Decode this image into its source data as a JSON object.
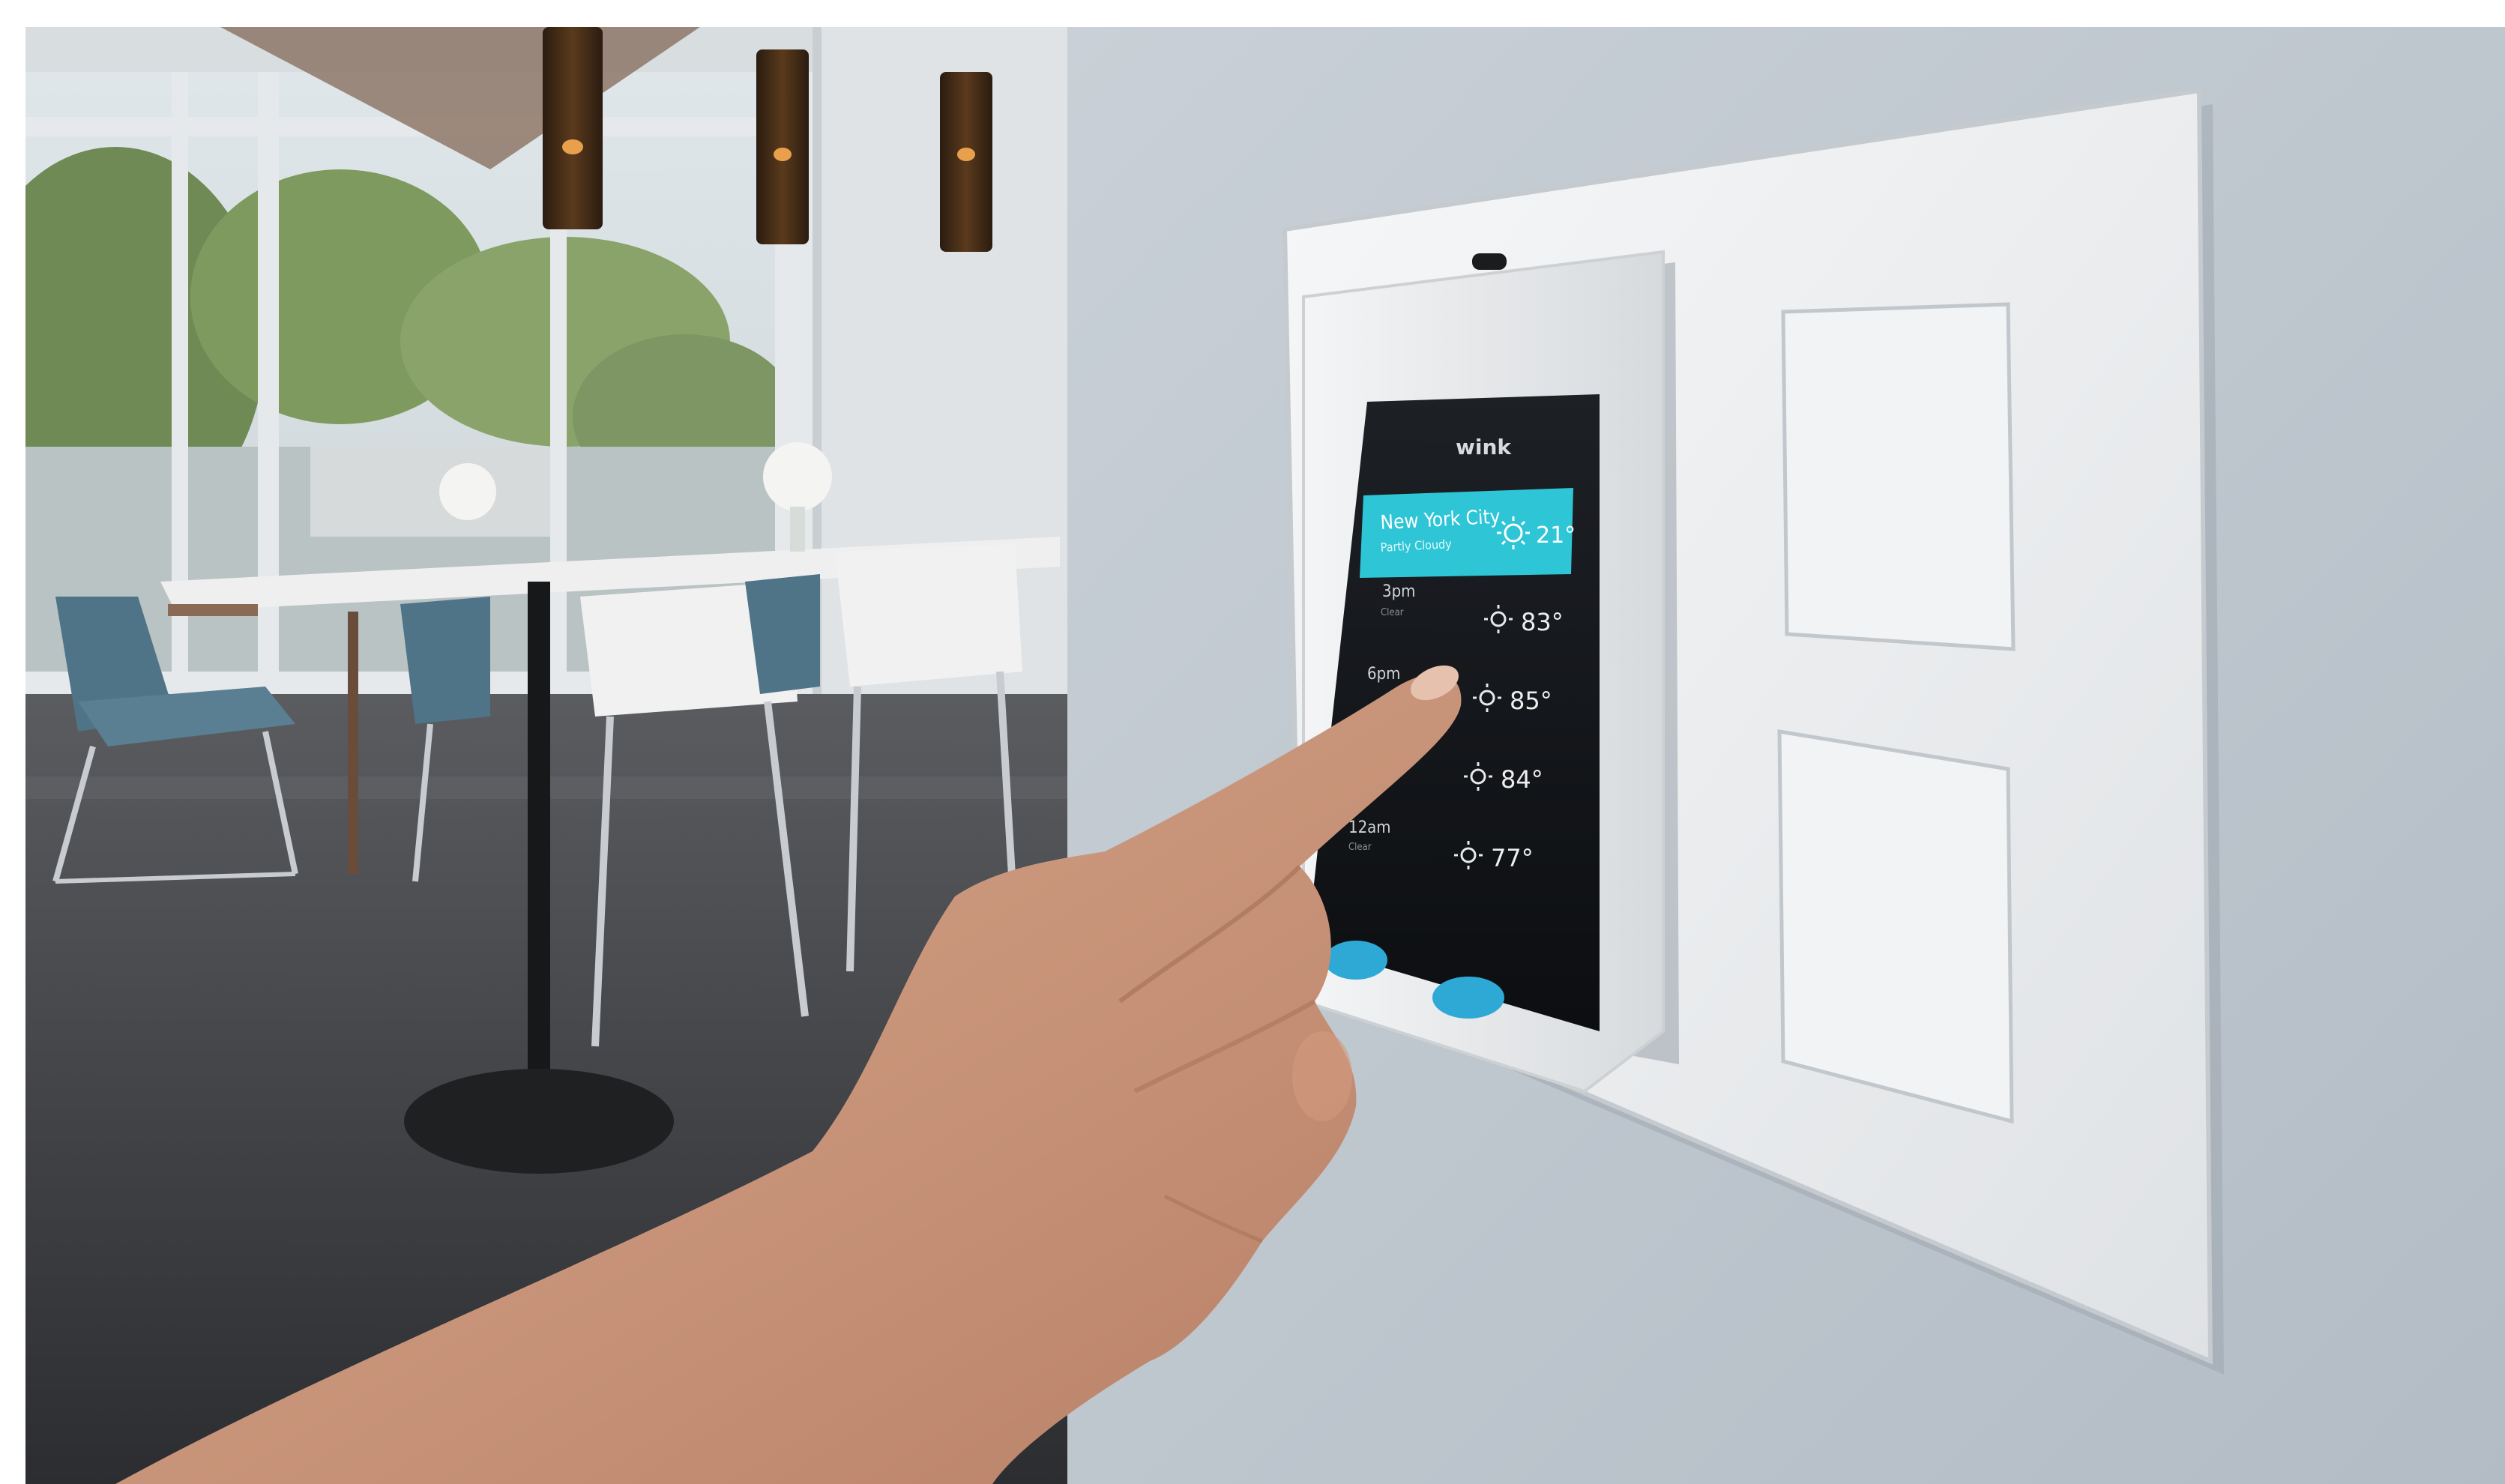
{
  "photo": {
    "subject": "Smart home wall touchscreen with a hand tapping the display in a modern dining room",
    "colors": {
      "wall": "#c2cad2",
      "plate": "#eef0f1",
      "screen_bg": "#14161a",
      "banner": "#2ec6d6",
      "floor": "#3d3f44",
      "skin": "#c79377"
    }
  },
  "device": {
    "brand": "wink",
    "banner": {
      "city": "New York City",
      "condition": "Partly Cloudy",
      "temp": "21°",
      "icon": "sun-icon"
    },
    "forecast": [
      {
        "time": "3pm",
        "condition": "Clear",
        "temp": "83°",
        "icon": "sun-icon"
      },
      {
        "time": "6pm",
        "condition": "",
        "temp": "85°",
        "icon": "sun-icon"
      },
      {
        "time": "",
        "condition": "",
        "temp": "84°",
        "icon": "sun-icon"
      },
      {
        "time": "12am",
        "condition": "Clear",
        "temp": "77°",
        "icon": "sun-icon"
      }
    ]
  }
}
